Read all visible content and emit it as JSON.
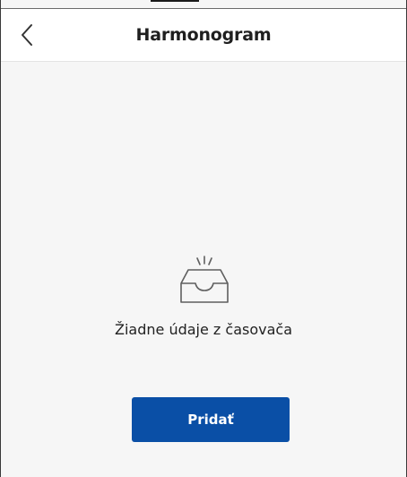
{
  "header": {
    "title": "Harmonogram",
    "back_icon": "chevron-left-icon"
  },
  "empty_state": {
    "icon": "empty-tray-icon",
    "message": "Žiadne údaje z časovača"
  },
  "actions": {
    "add_label": "Pridať"
  },
  "colors": {
    "primary": "#0a4fa6",
    "background": "#f6f6f6",
    "header_bg": "#ffffff",
    "text": "#222222"
  }
}
